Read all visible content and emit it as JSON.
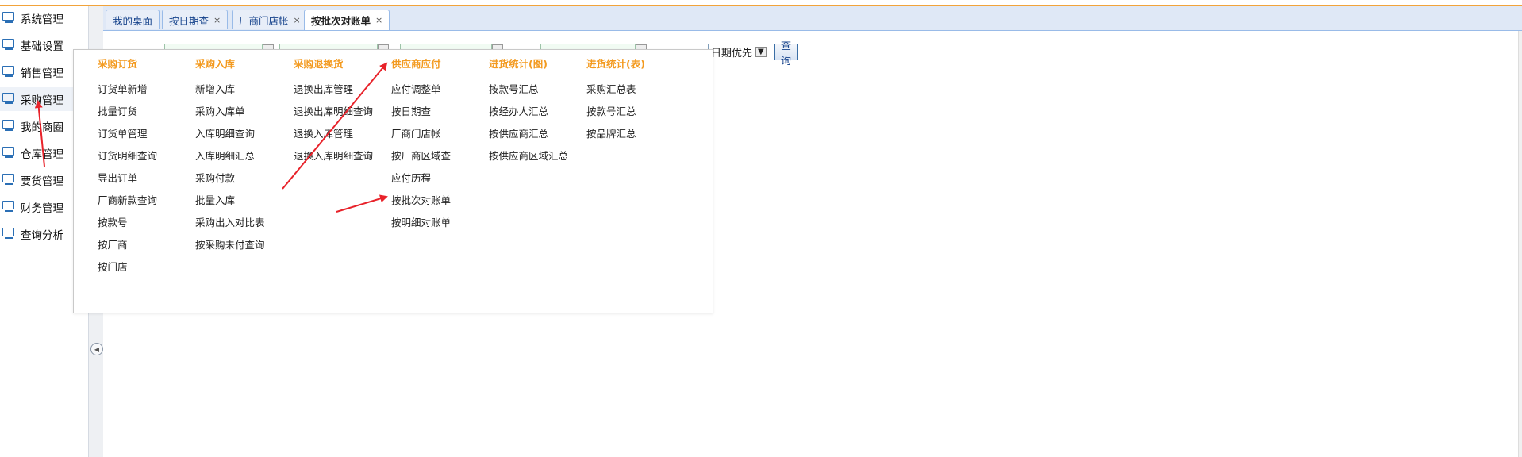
{
  "sidebar": {
    "items": [
      {
        "label": "系统管理",
        "icon": "monitor-icon"
      },
      {
        "label": "基础设置",
        "icon": "monitor-icon"
      },
      {
        "label": "销售管理",
        "icon": "monitor-icon"
      },
      {
        "label": "采购管理",
        "icon": "monitor-icon"
      },
      {
        "label": "我的商圈",
        "icon": "monitor-icon"
      },
      {
        "label": "仓库管理",
        "icon": "monitor-icon"
      },
      {
        "label": "要货管理",
        "icon": "monitor-icon"
      },
      {
        "label": "财务管理",
        "icon": "monitor-icon"
      },
      {
        "label": "查询分析",
        "icon": "monitor-icon"
      }
    ],
    "collapse_glyph": "◀"
  },
  "tabs": [
    {
      "label": "我的桌面",
      "close": ""
    },
    {
      "label": "按日期查",
      "close": "×"
    },
    {
      "label": "厂商门店帐",
      "close": "×"
    },
    {
      "label": "按批次对账单",
      "close": "×"
    }
  ],
  "filter": {
    "select_value": "日期优先",
    "query_label": "查 询"
  },
  "menu": {
    "columns": [
      {
        "heading": "采购订货",
        "items": [
          "订货单新增",
          "批量订货",
          "订货单管理",
          "订货明细查询",
          "导出订单",
          "厂商新款查询",
          "按款号",
          "按厂商",
          "按门店"
        ]
      },
      {
        "heading": "采购入库",
        "items": [
          "新增入库",
          "采购入库单",
          "入库明细查询",
          "入库明细汇总",
          "采购付款",
          "批量入库",
          "采购出入对比表",
          "按采购未付查询"
        ]
      },
      {
        "heading": "采购退换货",
        "items": [
          "退换出库管理",
          "退换出库明细查询",
          "退换入库管理",
          "退换入库明细查询"
        ]
      },
      {
        "heading": "供应商应付",
        "items": [
          "应付调整单",
          "按日期查",
          "厂商门店帐",
          "按厂商区域查",
          "应付历程",
          "按批次对账单",
          "按明细对账单"
        ]
      },
      {
        "heading": "进货统计(图)",
        "items": [
          "按款号汇总",
          "按经办人汇总",
          "按供应商汇总",
          "按供应商区域汇总"
        ]
      },
      {
        "heading": "进货统计(表)",
        "items": [
          "采购汇总表",
          "按款号汇总",
          "按品牌汇总"
        ]
      }
    ]
  },
  "colors": {
    "menu_heading": "#f39a1f",
    "accent_line": "#f2a33a",
    "annotation_arrow": "#e8222a"
  }
}
